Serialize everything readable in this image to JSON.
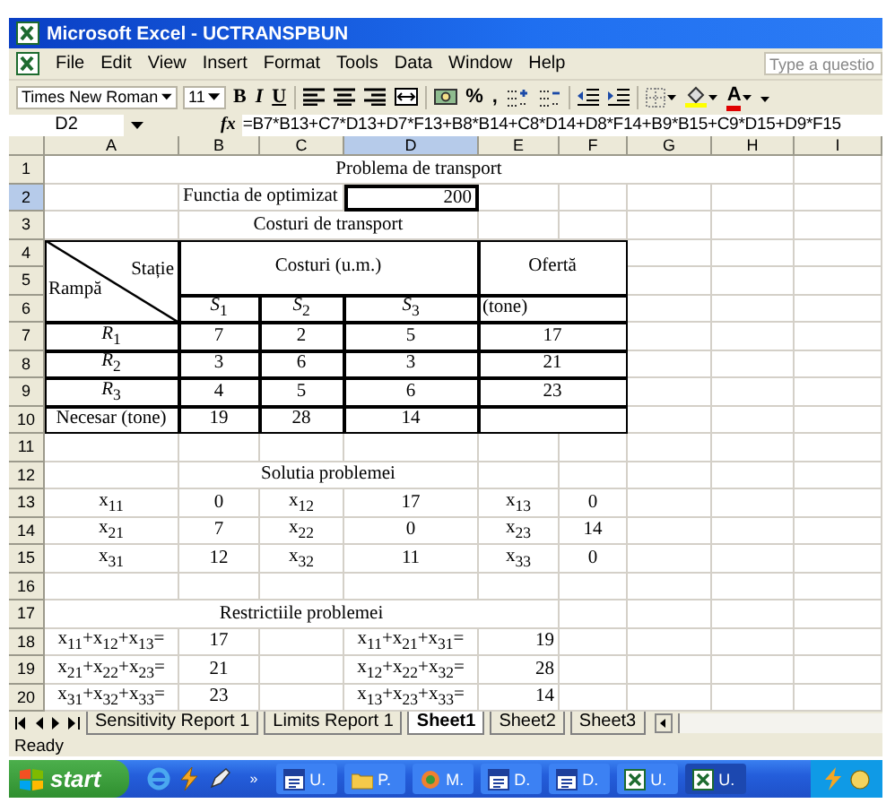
{
  "window": {
    "title": "Microsoft Excel - UCTRANSPBUN"
  },
  "menu": {
    "items": [
      "File",
      "Edit",
      "View",
      "Insert",
      "Format",
      "Tools",
      "Data",
      "Window",
      "Help"
    ],
    "help_box": {
      "placeholder": "Type a questio"
    }
  },
  "toolbar": {
    "font": "Times New Roman",
    "size": "11",
    "buttons": [
      {
        "kind": "bold",
        "label": "B"
      },
      {
        "kind": "italic",
        "label": "I"
      },
      {
        "kind": "underline",
        "label": "U"
      },
      {
        "kind": "align-left"
      },
      {
        "kind": "center"
      },
      {
        "kind": "align-right"
      },
      {
        "kind": "merge"
      },
      {
        "kind": "currency"
      },
      {
        "kind": "percent",
        "label": "%"
      },
      {
        "kind": "comma",
        "label": ","
      },
      {
        "kind": "increase-decimal"
      },
      {
        "kind": "decrease-decimal"
      },
      {
        "kind": "decrease-indent"
      },
      {
        "kind": "increase-indent"
      },
      {
        "kind": "borders"
      },
      {
        "kind": "fill-color"
      },
      {
        "kind": "font-color",
        "label": "A"
      },
      {
        "kind": "toolbar-options"
      }
    ]
  },
  "formula_bar": {
    "name_box": "D2",
    "function_label": "fx",
    "formula": "=B7*B13+C7*D13+D7*F13+B8*B14+C8*D14+D8*F14+B9*B15+C9*D15+D9*F15"
  },
  "sheet": {
    "columns": [
      {
        "label": "A",
        "selected": false
      },
      {
        "label": "B",
        "selected": false
      },
      {
        "label": "C",
        "selected": false
      },
      {
        "label": "D",
        "selected": true
      },
      {
        "label": "E",
        "selected": false
      },
      {
        "label": "F",
        "selected": false
      },
      {
        "label": "G",
        "selected": false
      },
      {
        "label": "H",
        "selected": false
      },
      {
        "label": "I",
        "selected": false
      }
    ],
    "rows": [
      {
        "number": "1",
        "selected": false,
        "cells": [
          {
            "kind": "center",
            "text": "Problema de transport"
          },
          {
            "kind": "merge_left"
          },
          {
            "kind": "merge_left"
          },
          {
            "kind": "merge_left"
          },
          {
            "kind": "merge_left"
          },
          {
            "kind": "merge_left"
          },
          {
            "kind": "merge_left"
          },
          {
            "kind": "merge_left"
          }
        ]
      },
      {
        "number": "2",
        "selected": true,
        "cells": [
          {
            "kind": "empty"
          },
          {
            "kind": "left",
            "text": "Functia de optimizat"
          },
          {
            "kind": "merge_left"
          },
          {
            "kind": "right",
            "text": "200",
            "active": true
          }
        ]
      },
      {
        "number": "3",
        "selected": false,
        "cells": [
          {
            "kind": "empty"
          },
          {
            "kind": "center",
            "text": "Costuri de transport"
          },
          {
            "kind": "merge_left"
          },
          {
            "kind": "merge_left"
          }
        ]
      },
      {
        "number": "4",
        "selected": false,
        "cells": [
          {
            "kind": "diagonal",
            "top_text": "Stație",
            "bottom_text": "Rampă",
            "thick_border": true
          },
          {
            "kind": "center",
            "text": "Costuri (u.m.)",
            "thick_border": true
          },
          {
            "kind": "merge_left"
          },
          {
            "kind": "merge_left"
          },
          {
            "kind": "center",
            "text": "Ofertă",
            "thick_border": true
          },
          {
            "kind": "merge_left"
          }
        ]
      },
      {
        "number": "5",
        "selected": false,
        "cells": [
          {
            "kind": "merge_up"
          },
          {
            "kind": "merge_up"
          },
          {
            "kind": "merge_up"
          },
          {
            "kind": "merge_up"
          },
          {
            "kind": "merge_up"
          },
          {
            "kind": "merge_up"
          }
        ]
      },
      {
        "number": "6",
        "selected": false,
        "cells": [
          {
            "kind": "merge_up"
          },
          {
            "kind": "center",
            "text": "*S*$_{1}$",
            "thick_border": true
          },
          {
            "kind": "center",
            "text": "*S*$_{2}$",
            "thick_border": true
          },
          {
            "kind": "center",
            "text": "*S*$_{3}$",
            "thick_border": true
          },
          {
            "kind": "left",
            "text": "(tone)",
            "thick_border": true
          },
          {
            "kind": "merge_left"
          }
        ]
      },
      {
        "number": "7",
        "selected": false,
        "cells": [
          {
            "kind": "center",
            "text": "*R*$_{1}$",
            "thick_border": true
          },
          {
            "kind": "center",
            "text": "7",
            "thick_border": true
          },
          {
            "kind": "center",
            "text": "2",
            "thick_border": true
          },
          {
            "kind": "center",
            "text": "5",
            "thick_border": true
          },
          {
            "kind": "center",
            "text": "17",
            "thick_border": true
          },
          {
            "kind": "merge_left"
          }
        ]
      },
      {
        "number": "8",
        "selected": false,
        "cells": [
          {
            "kind": "center",
            "text": "*R*$_{2}$",
            "thick_border": true
          },
          {
            "kind": "center",
            "text": "3",
            "thick_border": true
          },
          {
            "kind": "center",
            "text": "6",
            "thick_border": true
          },
          {
            "kind": "center",
            "text": "3",
            "thick_border": true
          },
          {
            "kind": "center",
            "text": "21",
            "thick_border": true
          },
          {
            "kind": "merge_left"
          }
        ]
      },
      {
        "number": "9",
        "selected": false,
        "cells": [
          {
            "kind": "center",
            "text": "*R*$_{3}$",
            "thick_border": true
          },
          {
            "kind": "center",
            "text": "4",
            "thick_border": true
          },
          {
            "kind": "center",
            "text": "5",
            "thick_border": true
          },
          {
            "kind": "center",
            "text": "6",
            "thick_border": true
          },
          {
            "kind": "center",
            "text": "23",
            "thick_border": true
          },
          {
            "kind": "merge_left"
          }
        ]
      },
      {
        "number": "10",
        "selected": false,
        "cells": [
          {
            "kind": "center",
            "text": "Necesar (tone)",
            "thick_border": true
          },
          {
            "kind": "center",
            "text": "19",
            "thick_border": true
          },
          {
            "kind": "center",
            "text": "28",
            "thick_border": true
          },
          {
            "kind": "center",
            "text": "14",
            "thick_border": true
          },
          {
            "kind": "empty",
            "thick_border": true
          },
          {
            "kind": "merge_left"
          }
        ]
      },
      {
        "number": "11",
        "selected": false
      },
      {
        "number": "12",
        "selected": false,
        "cells": [
          {
            "kind": "empty"
          },
          {
            "kind": "center",
            "text": "Solutia problemei"
          },
          {
            "kind": "merge_left"
          },
          {
            "kind": "merge_left"
          }
        ]
      },
      {
        "number": "13",
        "selected": false,
        "cells": [
          {
            "kind": "center",
            "text": "x$_{11}$"
          },
          {
            "kind": "center",
            "text": "0"
          },
          {
            "kind": "center",
            "text": "x$_{12}$"
          },
          {
            "kind": "center",
            "text": "17"
          },
          {
            "kind": "center",
            "text": "x$_{13}$"
          },
          {
            "kind": "center",
            "text": "0"
          }
        ]
      },
      {
        "number": "14",
        "selected": false,
        "cells": [
          {
            "kind": "center",
            "text": "x$_{21}$"
          },
          {
            "kind": "center",
            "text": "7"
          },
          {
            "kind": "center",
            "text": "x$_{22}$"
          },
          {
            "kind": "center",
            "text": "0"
          },
          {
            "kind": "center",
            "text": "x$_{23}$"
          },
          {
            "kind": "center",
            "text": "14"
          }
        ]
      },
      {
        "number": "15",
        "selected": false,
        "cells": [
          {
            "kind": "center",
            "text": "x$_{31}$"
          },
          {
            "kind": "center",
            "text": "12"
          },
          {
            "kind": "center",
            "text": "x$_{32}$"
          },
          {
            "kind": "center",
            "text": "11"
          },
          {
            "kind": "center",
            "text": "x$_{33}$"
          },
          {
            "kind": "center",
            "text": "0"
          }
        ]
      },
      {
        "number": "16",
        "selected": false
      },
      {
        "number": "17",
        "selected": false,
        "cells": [
          {
            "kind": "center",
            "text": "Restrictiile problemei"
          },
          {
            "kind": "merge_left"
          },
          {
            "kind": "merge_left"
          },
          {
            "kind": "merge_left"
          },
          {
            "kind": "merge_left"
          }
        ]
      },
      {
        "number": "18",
        "selected": false,
        "cells": [
          {
            "kind": "center",
            "text": "x$_{11}$+x$_{12}$+x$_{13}$="
          },
          {
            "kind": "center",
            "text": "17"
          },
          {
            "kind": "empty"
          },
          {
            "kind": "center",
            "text": "x$_{11}$+x$_{21}$+x$_{31}$="
          },
          {
            "kind": "right",
            "text": "19"
          }
        ]
      },
      {
        "number": "19",
        "selected": false,
        "cells": [
          {
            "kind": "center",
            "text": "x$_{21}$+x$_{22}$+x$_{23}$="
          },
          {
            "kind": "center",
            "text": "21"
          },
          {
            "kind": "empty"
          },
          {
            "kind": "center",
            "text": "x$_{12}$+x$_{22}$+x$_{32}$="
          },
          {
            "kind": "right",
            "text": "28"
          }
        ]
      },
      {
        "number": "20",
        "selected": false,
        "cells": [
          {
            "kind": "center",
            "text": "x$_{31}$+x$_{32}$+x$_{33}$="
          },
          {
            "kind": "center",
            "text": "23"
          },
          {
            "kind": "empty"
          },
          {
            "kind": "center",
            "text": "x$_{13}$+x$_{23}$+x$_{33}$="
          },
          {
            "kind": "right",
            "text": "14"
          }
        ]
      }
    ]
  },
  "sheet_tabs": [
    {
      "label": "Sensitivity Report 1",
      "selected": false
    },
    {
      "label": "Limits Report 1",
      "selected": false
    },
    {
      "label": "Sheet1",
      "selected": true
    },
    {
      "label": "Sheet2",
      "selected": false
    },
    {
      "label": "Sheet3",
      "selected": false
    }
  ],
  "status_bar": {
    "text": "Ready"
  },
  "taskbar": {
    "start": "start",
    "more": "»",
    "tasks": [
      {
        "kind": "document",
        "label": "U.",
        "selected": false
      },
      {
        "kind": "folder",
        "label": "P.",
        "selected": false
      },
      {
        "kind": "player",
        "label": "M.",
        "selected": false
      },
      {
        "kind": "document",
        "label": "D.",
        "selected": false
      },
      {
        "kind": "document",
        "label": "D.",
        "selected": false
      },
      {
        "kind": "spreadsheet",
        "label": "U.",
        "selected": false
      },
      {
        "kind": "spreadsheet",
        "label": "U.",
        "selected": true
      }
    ]
  }
}
